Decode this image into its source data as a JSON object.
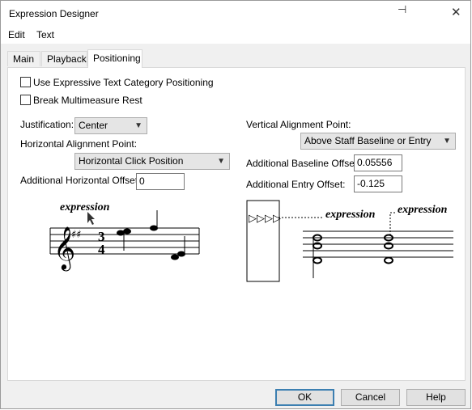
{
  "window": {
    "title": "Expression Designer"
  },
  "menu": {
    "edit": "Edit",
    "text": "Text"
  },
  "tabs": {
    "main": "Main",
    "playback": "Playback",
    "positioning": "Positioning"
  },
  "options": {
    "use_category": "Use Expressive Text Category Positioning",
    "break_mm": "Break Multimeasure Rest"
  },
  "justification": {
    "label": "Justification:",
    "value": "Center"
  },
  "horizontal": {
    "label": "Horizontal Alignment Point:",
    "value": "Horizontal Click Position"
  },
  "h_offset": {
    "label": "Additional Horizontal Offset:",
    "value": "0"
  },
  "vertical": {
    "label": "Vertical Alignment Point:",
    "value": "Above Staff Baseline or Entry"
  },
  "baseline_offset": {
    "label": "Additional Baseline Offset:",
    "value": "0.05556"
  },
  "entry_offset": {
    "label": "Additional Entry Offset:",
    "value": "-0.125"
  },
  "preview": {
    "expression_left": "expression",
    "expression_mid": "expression",
    "expression_right": "expression"
  },
  "buttons": {
    "ok": "OK",
    "cancel": "Cancel",
    "help": "Help"
  }
}
